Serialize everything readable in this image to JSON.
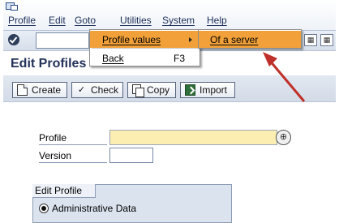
{
  "menubar": {
    "items": [
      "Profile",
      "Edit",
      "Goto",
      "Utilities",
      "System",
      "Help"
    ]
  },
  "page": {
    "title": "Edit Profiles"
  },
  "appbar": {
    "buttons": [
      "Create",
      "Check",
      "Copy",
      "Import"
    ]
  },
  "form": {
    "profile_label": "Profile",
    "version_label": "Version",
    "profile_value": "",
    "version_value": ""
  },
  "group": {
    "title": "Edit Profile",
    "option": "Administrative Data"
  },
  "goto_menu": {
    "items": [
      {
        "label": "Profile values",
        "shortcut": ""
      },
      {
        "label": "Back",
        "shortcut": "F3"
      }
    ]
  },
  "submenu": {
    "items": [
      "Of a server"
    ]
  },
  "colors": {
    "highlight": "#f2a13a",
    "annotation_arrow": "#c0302a",
    "required_field": "#fbeeb0"
  }
}
